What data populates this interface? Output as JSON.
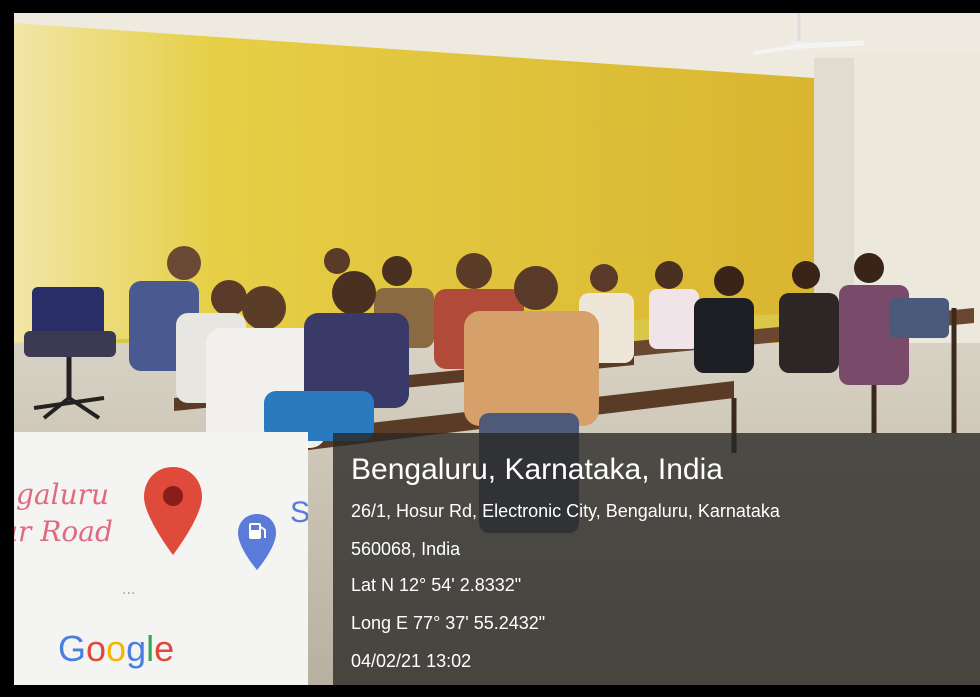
{
  "photo": {
    "description_icons": [
      "map-pin-icon",
      "gas-station-icon",
      "google-logo"
    ]
  },
  "map": {
    "city_fragment": "ngaluru",
    "road_fragment": "ur Road",
    "dots": "...",
    "gas_fragment": "S",
    "logo_letters": [
      {
        "ch": "G",
        "color": "#4a7fe0"
      },
      {
        "ch": "o",
        "color": "#e04a3a"
      },
      {
        "ch": "o",
        "color": "#f2b800"
      },
      {
        "ch": "g",
        "color": "#4a7fe0"
      },
      {
        "ch": "l",
        "color": "#34a853"
      },
      {
        "ch": "e",
        "color": "#e04a3a"
      }
    ]
  },
  "geotag": {
    "place": "Bengaluru, Karnataka, India",
    "address_line1": "26/1, Hosur Rd, Electronic City, Bengaluru, Karnataka",
    "address_line2": "560068, India",
    "latitude": "Lat N 12° 54' 2.8332\"",
    "longitude": "Long E 77° 37' 55.2432\"",
    "datetime": "04/02/21 13:02"
  },
  "colors": {
    "wall": "#e0c93c",
    "overlay": "#2b2826",
    "map_pin": "#e04a3a"
  }
}
